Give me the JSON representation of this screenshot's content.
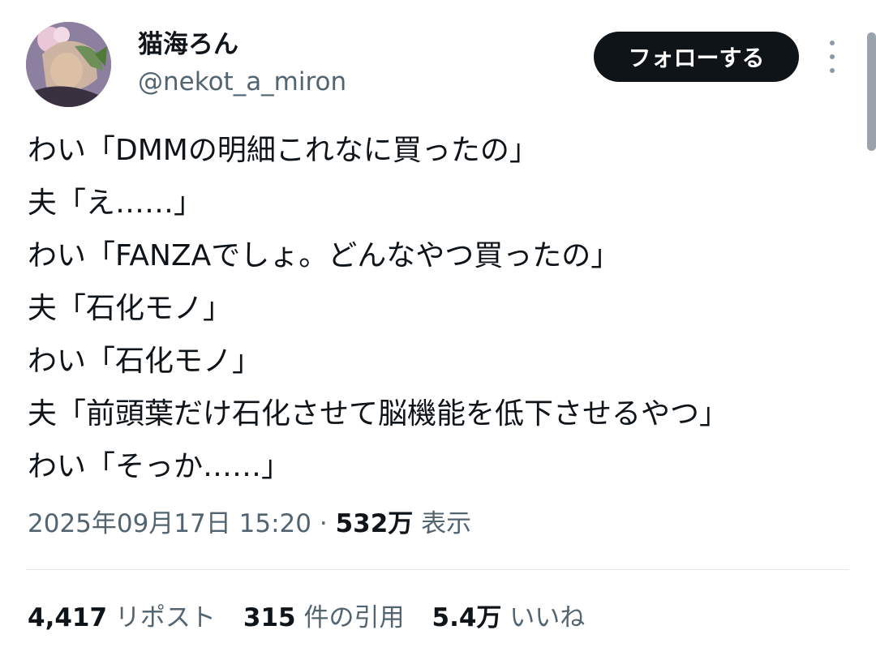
{
  "user": {
    "display_name": "猫海ろん",
    "handle": "@nekot_a_miron",
    "avatar_icon": "user-avatar"
  },
  "actions": {
    "follow_label": "フォローする",
    "more_icon": "more-vertical-icon"
  },
  "tweet": {
    "lines": [
      "わい「DMMの明細これなに買ったの」",
      "夫「え……」",
      "わい「FANZAでしょ。どんなやつ買ったの」",
      "夫「石化モノ」",
      "わい「石化モノ」",
      "夫「前頭葉だけ石化させて脳機能を低下させるやつ」",
      "わい「そっか……」"
    ]
  },
  "meta": {
    "timestamp": "2025年09月17日 15:20",
    "separator": "·",
    "views_count": "532万",
    "views_label": "表示"
  },
  "stats": {
    "reposts_count": "4,417",
    "reposts_label": "リポスト",
    "quotes_count": "315",
    "quotes_label": "件の引用",
    "likes_count": "5.4万",
    "likes_label": "いいね"
  },
  "colors": {
    "text_primary": "#0f1419",
    "text_secondary": "#536471",
    "button_bg": "#0f1419",
    "divider": "#e1e6ea"
  }
}
